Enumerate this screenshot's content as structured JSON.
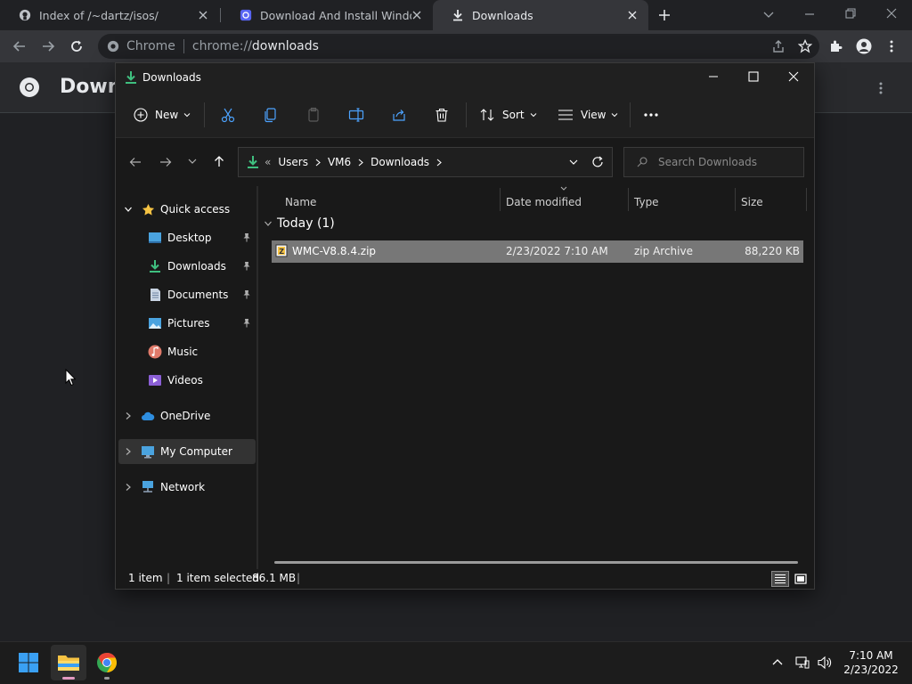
{
  "browser": {
    "tabs": [
      {
        "title": "Index of /~dartz/isos/",
        "active": false
      },
      {
        "title": "Download And Install Windows M",
        "active": false
      },
      {
        "title": "Downloads",
        "active": true
      }
    ],
    "new_tab_label": "+",
    "omnibox": {
      "chrome_label": "Chrome",
      "scheme": "chrome://",
      "host": "downloads"
    },
    "page_title": "Downloads"
  },
  "explorer": {
    "title": "Downloads",
    "commands": {
      "new": "New",
      "sort": "Sort",
      "view": "View"
    },
    "address": {
      "overflow": "«",
      "segments": [
        "Users",
        "VM6",
        "Downloads"
      ]
    },
    "search_placeholder": "Search Downloads",
    "sidebar": {
      "quick_access": "Quick access",
      "items": [
        {
          "label": "Desktop",
          "icon": "desktop-icon",
          "pinned": true
        },
        {
          "label": "Downloads",
          "icon": "downloads-icon",
          "pinned": true
        },
        {
          "label": "Documents",
          "icon": "documents-icon",
          "pinned": true
        },
        {
          "label": "Pictures",
          "icon": "pictures-icon",
          "pinned": true
        },
        {
          "label": "Music",
          "icon": "music-icon",
          "pinned": false
        },
        {
          "label": "Videos",
          "icon": "videos-icon",
          "pinned": false
        }
      ],
      "onedrive": "OneDrive",
      "my_computer": "My Computer",
      "network": "Network"
    },
    "columns": {
      "name": "Name",
      "date": "Date modified",
      "type": "Type",
      "size": "Size"
    },
    "group": "Today (1)",
    "files": [
      {
        "name": "WMC-V8.8.4.zip",
        "date": "2/23/2022 7:10 AM",
        "type": "zip Archive",
        "size": "88,220 KB"
      }
    ],
    "status": {
      "count": "1 item",
      "selected": "1 item selected",
      "size": "86.1 MB"
    }
  },
  "taskbar": {
    "time": "7:10 AM",
    "date": "2/23/2022"
  },
  "colors": {
    "accent_green": "#3fbf7f",
    "folder_yellow": "#f6c343",
    "selection": "#777777"
  }
}
